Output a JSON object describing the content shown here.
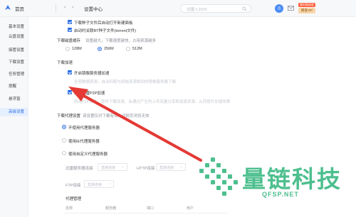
{
  "app": {
    "home_label": "首页",
    "window_title": "设置中心"
  },
  "topbar": {
    "search_placeholder": "迅雷入2020",
    "avatar_text": "迅",
    "vip_top": "限时高体验",
    "vip_bottom": "网盘VIP"
  },
  "sidebar": {
    "items": [
      {
        "label": "基本设置"
      },
      {
        "label": "云盘设置"
      },
      {
        "label": "接管设置"
      },
      {
        "label": "下载设置"
      },
      {
        "label": "任务管理"
      },
      {
        "label": "提醒"
      },
      {
        "label": "悬浮窗"
      },
      {
        "label": "高级设置"
      }
    ],
    "active_index": 7
  },
  "content": {
    "torrent_options": [
      {
        "label": "下载种子文件后自动打开新建面板",
        "checked": true
      },
      {
        "label": "启动时关联BT种子文件(torrent文件)",
        "checked": true
      }
    ],
    "speed_limit": {
      "label": "下载磁盘缓存",
      "hint": "设置越大，下载速度越快，占用资源越多",
      "options": [
        "128M",
        "256M",
        "512M"
      ],
      "selected": "256M"
    },
    "accel": {
      "section_label": "下载加速",
      "mirror_label": "开启镜像服务器加速",
      "mirror_hint": "全局数据资源，自动匹配与原始资源相同的镜像服务器下载",
      "p2p_label": "开启迅雷P2P加速",
      "p2p_hint": "利用P2P技术，提供下载加速，会通过产生的上传流量分享和加速资源，从而提升加速效果"
    },
    "proxy": {
      "section_label": "下载代理设置",
      "hint": "该设置仅对下载有效，对网页浏览无效",
      "options": [
        "不使用代理服务器",
        "使用IE代理服务器",
        "使用自定义代理服务器"
      ],
      "selected": "不使用代理服务器",
      "http_label": "迅雷服务器连接",
      "http_select": "直接连接",
      "http2_label": "HTTP连接",
      "http2_select": "直接连接",
      "ftp_label": "FTP连接",
      "ftp_select": "直接连接",
      "manage_label": "代理管理",
      "table_headers": [
        "名称",
        "服务器",
        "端口",
        "用户"
      ]
    }
  },
  "watermark": {
    "title": "量链科技",
    "url": "QFSP.NET"
  },
  "colors": {
    "accent": "#2b6fe6",
    "arrow": "#e53935",
    "watermark": "#4dbf8e"
  }
}
